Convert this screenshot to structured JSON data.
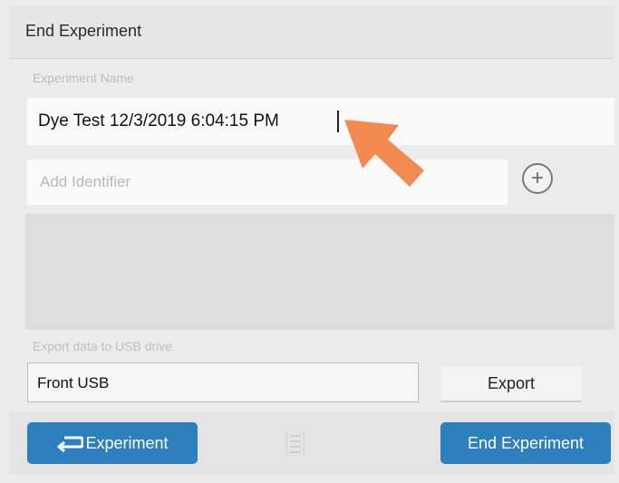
{
  "dialog": {
    "title": "End Experiment",
    "experiment_name_label": "Experiment Name",
    "experiment_name_value": "Dye Test 12/3/2019 6:04:15 PM",
    "identifier_placeholder": "Add Identifier",
    "export_label": "Export data to USB drive",
    "usb_selected": "Front USB",
    "export_button": "Export"
  },
  "footer": {
    "back_button": "Experiment",
    "end_button": "End Experiment"
  },
  "colors": {
    "primary_button": "#2e7fbe",
    "pointer_annotation": "#f28a50"
  },
  "icons": {
    "add": "plus-circle-icon",
    "back": "return-arrow-icon",
    "grip": "drag-handle-icon",
    "annotation": "arrow-pointer-icon"
  }
}
